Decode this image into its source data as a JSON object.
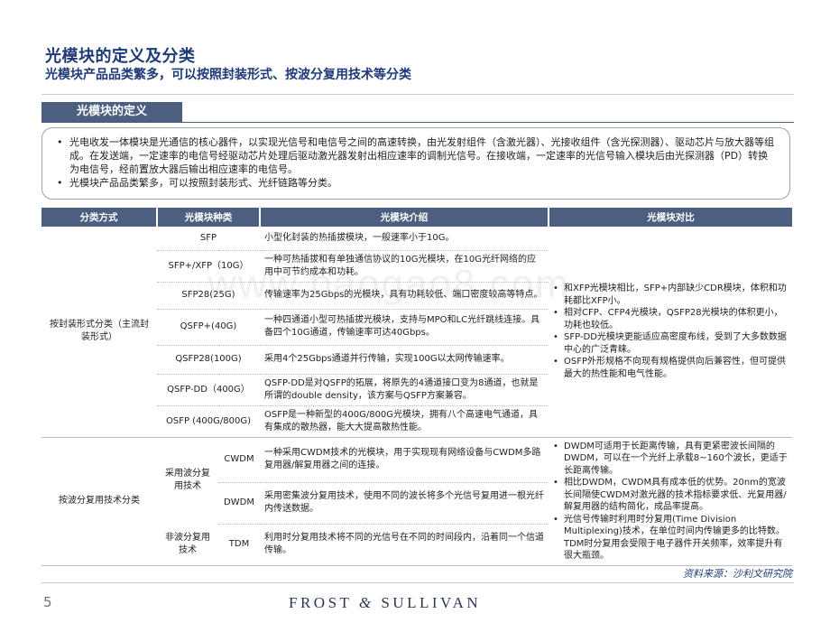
{
  "header": {
    "title": "光模块的定义及分类",
    "subtitle": "光模块产品品类繁多，可以按照封装形式、按波分复用技术等分类"
  },
  "section": {
    "label": "光模块的定义"
  },
  "definition": {
    "bullets": [
      "光电收发一体模块是光通信的核心器件，以实现光信号和电信号之间的高速转换，由光发射组件（含激光器）、光接收组件（含光探测器）、驱动芯片与放大器等组成。在发送端，一定速率的电信号经驱动芯片处理后驱动激光器发射出相应速率的调制光信号。在接收端，一定速率的光信号输入模块后由光探测器（PD）转换为电信号，经前置放大器后输出相应速率的电信号。",
      "光模块产品品类繁多，可以按照封装形式、光纤链路等分类。"
    ]
  },
  "table": {
    "headers": [
      "分类方式",
      "光模块种类",
      "光模块介绍",
      "光模块对比"
    ],
    "package": {
      "method": "按封装形式分类（主流封装形式）",
      "rows": [
        {
          "type": "SFP",
          "intro": "小型化封装的热插拔模块，一般速率小于10G。"
        },
        {
          "type": "SFP+/XFP（10G）",
          "intro": "一种可热插拔和有单独通信协议的10G光模块，在10G光纤网络的应用中可节约成本和功耗。"
        },
        {
          "type": "SFP28(25G)",
          "intro": "传输速率为25Gbps的光模块，具有功耗较低、端口密度较高等特点。"
        },
        {
          "type": "QSFP+(40G)",
          "intro": "一种四通道小型可热插拔光模块，支持与MPO和LC光纤跳线连接。具备四个10G通道，传输速率可达40Gbps。"
        },
        {
          "type": "QSFP28(100G)",
          "intro": "采用4个25Gbps通道并行传输，实现100G以太网传输速率。"
        },
        {
          "type": "QSFP-DD（400G）",
          "intro": "QSFP-DD是对QSFP的拓展，将原先的4通道接口变为8通道，也就是所谓的double density，该方案与QSFP方案兼容。"
        },
        {
          "type": "OSFP (400G/800G)",
          "intro": "OSFP是一种新型的400G/800G光模块，拥有八个高速电气通道，具有集成的散热器，能大大提高散热性能。"
        }
      ],
      "comparison": [
        "和XFP光模块相比，SFP+内部缺少CDR模块，体积和功耗都比XFP小。",
        "相对CFP、CFP4光模块，QSFP28光模块的体积更小，功耗也较低。",
        "SFP-DD光模块更能适应高密度布线，受到了大多数数据中心的广泛青睐。",
        "OSFP外形规格不向现有规格提供向后兼容性，但可提供最大的热性能和电气性能。"
      ]
    },
    "wdm": {
      "method": "按波分复用技术分类",
      "subgroup_wdm": "采用波分复用技术",
      "subgroup_non": "非波分复用技术",
      "rows": [
        {
          "type": "CWDM",
          "intro": "一种采用CWDM技术的光模块，用于实现现有网络设备与CWDM多路复用器/解复用器之间的连接。"
        },
        {
          "type": "DWDM",
          "intro": "采用密集波分复用技术，使用不同的波长将多个光信号复用进一根光纤内传送数据。"
        },
        {
          "type": "TDM",
          "intro": "利用时分复用技术将不同的光信号在不同的时间段内，沿着同一个信道传输。"
        }
      ],
      "comparison": [
        "DWDM可适用于长距离传输，具有更紧密波长间隔的DWDM，可以在一个光纤上承载8~160个波长，更适于长距离传输。",
        "相比DWDM，CWDM具有成本低的优势。20nm的宽波长间隔使CWDM对激光器的技术指标要求低、光复用器/解复用器的结构简化，成品率提高。",
        "光信号传输时利用时分复用(Time Division Multiplexing)技术，在单位时间内传输更多的比特数。TDM时分复用会受限于电子器件开关频率，效率提升有很大瓶颈。"
      ]
    }
  },
  "watermark": "www.baogao8.com",
  "footer": {
    "source": "资料来源：沙利文研究院",
    "page_number": "5",
    "brand_left": "FROST",
    "brand_amp": "&",
    "brand_right": "SULLIVAN"
  },
  "colors": {
    "title": "#1f3a78",
    "header_fill": "#4c5f80",
    "border": "#b8bdc8"
  }
}
